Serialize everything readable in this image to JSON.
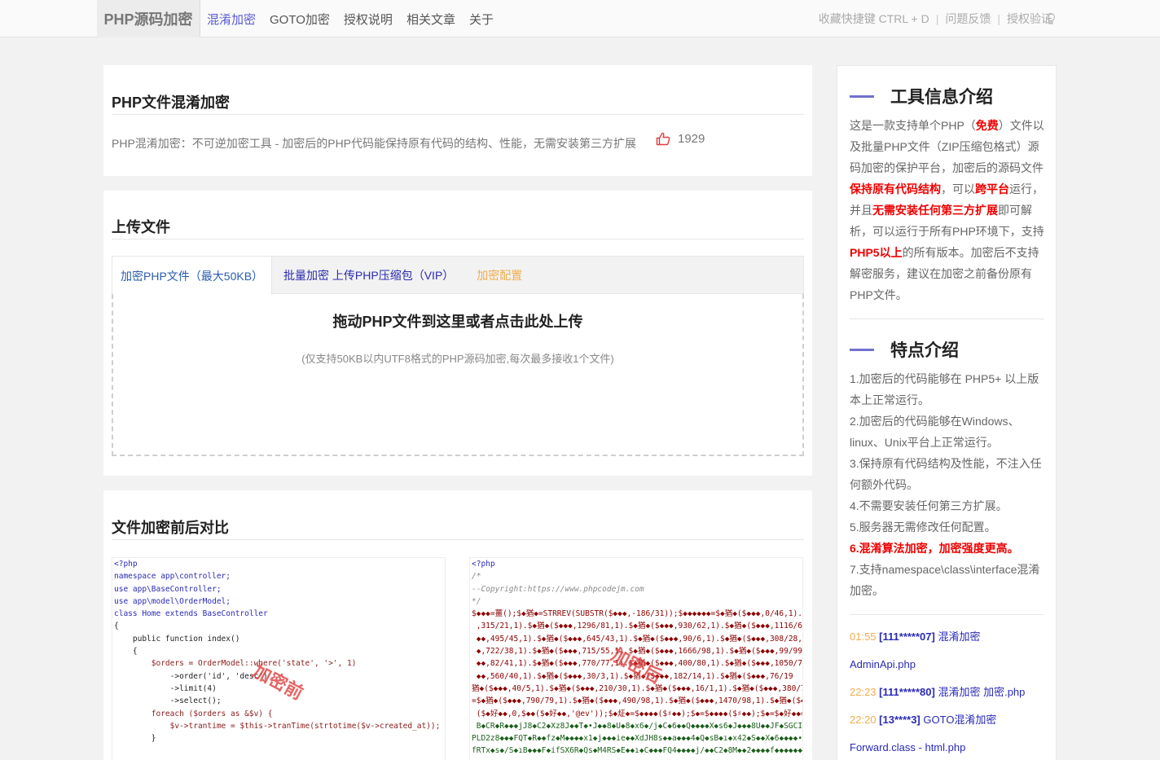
{
  "nav": {
    "brand": "PHP源码加密",
    "links": [
      "混淆加密",
      "GOTO加密",
      "授权说明",
      "相关文章",
      "关于"
    ],
    "right": [
      "收藏快捷键 CTRL + D",
      "问题反馈",
      "授权验证"
    ],
    "separator": "|"
  },
  "header_card": {
    "title": "PHP文件混淆加密",
    "description": "PHP混淆加密：不可逆加密工具 - 加密后的PHP代码能保持原有代码的结构、性能，无需安装第三方扩展",
    "likes": "1929"
  },
  "upload": {
    "title": "上传文件",
    "tabs": [
      "加密PHP文件（最大50KB）",
      "批量加密 上传PHP压缩包（VIP）",
      "加密配置"
    ],
    "drop_main": "拖动PHP文件到这里或者点击此处上传",
    "drop_sub": "(仅支持50KB以内UTF8格式的PHP源码加密,每次最多接收1个文件)"
  },
  "compare": {
    "title": "文件加密前后对比",
    "stamp_before": "加密前",
    "stamp_after": "加密后",
    "before_code": [
      "<?php",
      "namespace app\\controller;",
      "use app\\BaseController;",
      "use app\\model\\OrderModel;",
      "class Home extends BaseController",
      "{",
      "    public function index()",
      "    {",
      "        $orders = OrderModel::where('state', '>', 1)",
      "            ->order('id', 'desc')",
      "            ->limit(4)",
      "            ->select();",
      "        foreach ($orders as &$v) {",
      "            $v->trantime = $this->tranTime(strtotime($v->created_at));",
      "        }"
    ],
    "after_code": [
      "<?php",
      "/*",
      "--Copyright:https://www.phpcodejm.com",
      "*/",
      "$◆◆◆=薑();$◆猶◆=STRREV(SUBSTR($◆◆◆,-186/31));$◆◆◆◆◆◆=$◆猶◆($◆◆◆,0/46,1).$◆猶",
      " ,315/21,1).$◆猶◆($◆◆◆,1296/81,1).$◆猶◆($◆◆◆,930/62,1).$◆猶◆($◆◆◆,1116/62,1)",
      " ◆◆,495/45,1).$◆猶◆($◆◆◆,645/43,1).$◆猶◆($◆◆◆,90/6,1).$◆猶◆($◆◆◆,308/28,1).$",
      " ◆,722/38,1).$◆猶◆($◆◆◆,715/55,1).$◆猶◆($◆◆◆,1666/98,1).$◆猶◆($◆◆◆,99/99,1).",
      " ◆◆,82/41,1).$◆猶◆($◆◆◆,770/77,1).$◆猶◆($◆◆◆,400/80,1).$◆猶◆($◆◆◆,1050/70,1)",
      " ◆◆,560/40,1).$◆猶◆($◆◆◆,30/3,1).$◆猶◆($◆◆◆,182/14,1).$◆猶◆($◆◆◆,76/19",
      "猶◆($◆◆◆,40/5,1).$◆猶◆($◆◆◆,210/30,1).$◆猶◆($◆◆◆,16/1,1).$◆猶◆($◆◆◆,380/75,",
      "=$◆猶◆($◆◆◆,790/79,1).$◆猶◆($◆◆◆,490/98,1).$◆猶◆($◆◆◆,1470/98,1).$◆猶◆($◆◆◆",
      " ($◆好◆◆,0,$◆◆($◆好◆◆,'@ev'));$◆炡◆=$◆◆◆◆($♯◆◆);$◆=$◆◆◆◆($♯◆◆);$◆=$◆好◆◆=$",
      " B◆CR◆R◆◆◆jJ8◆C2◆Xz8J◆◆T◆•J◆◆8◆U◆8◆x6◆/j◆C◆6◆◆Q◆◆◆◆X◆s6◆J◆◆◆8U◆◆JF◆SGCIa",
      "PLD2z8◆◆◆FQT◆R◆◆fz◆M◆◆◆◆x1◆j◆◆◆ie◆◆XdJH8s◆◆a◆◆◆4◆Q◆sB◆ı◆x42◆S◆◆X◆6◆◆◆◆•◆◆a",
      "fRTx◆s◆/S◆ıB◆◆◆F◆ifSX6R◆Qs◆M4RS◆E◆◆ı◆C◆◆◆FQ4◆◆◆◆j/◆◆C2◆8M◆◆2◆◆◆◆f◆◆◆◆◆◆+ef"
    ]
  },
  "sidebar": {
    "intro_title": "工具信息介绍",
    "intro_parts": [
      {
        "t": "这是一款支持单个PHP（",
        "red": false
      },
      {
        "t": "免费",
        "red": true
      },
      {
        "t": "）文件以及批量PHP文件（ZIP压缩包格式）源码加密的保护平台，加密后的源码文件",
        "red": false
      },
      {
        "t": "保持原有代码结构",
        "red": true
      },
      {
        "t": "，可以",
        "red": false
      },
      {
        "t": "跨平台",
        "red": true
      },
      {
        "t": "运行，并且",
        "red": false
      },
      {
        "t": "无需安装任何第三方扩展",
        "red": true
      },
      {
        "t": "即可解析，可以运行于所有PHP环境下，支持",
        "red": false
      },
      {
        "t": "PHP5以上",
        "red": true
      },
      {
        "t": "的所有版本。加密后不支持解密服务，建议在加密之前备份原有PHP文件。",
        "red": false
      }
    ],
    "features_title": "特点介绍",
    "features": [
      {
        "t": "1.加密后的代码能够在 PHP5+ 以上版本上正常运行。",
        "red": false
      },
      {
        "t": "2.加密后的代码能够在Windows、linux、Unix平台上正常运行。",
        "red": false
      },
      {
        "t": "3.保持原有代码结构及性能，不注入任何额外代码。",
        "red": false
      },
      {
        "t": "4.不需要安装任何第三方扩展。",
        "red": false
      },
      {
        "t": "5.服务器无需修改任何配置。",
        "red": false
      },
      {
        "t": "6.混淆算法加密，加密强度更高。",
        "red": true
      },
      {
        "t": "7.支持namespace\\class\\interface混淆加密。",
        "red": false
      }
    ],
    "logs": [
      {
        "time": "01:55",
        "who": "[111*****07]",
        "msg": "混淆加密",
        "file": "AdminApi.php"
      },
      {
        "time": "22:23",
        "who": "[111*****80]",
        "msg": "混淆加密 加密.php",
        "file": ""
      },
      {
        "time": "22:20",
        "who": "[13****3]",
        "msg": "GOTO混淆加密",
        "file": "Forward.class - html.php"
      }
    ]
  }
}
